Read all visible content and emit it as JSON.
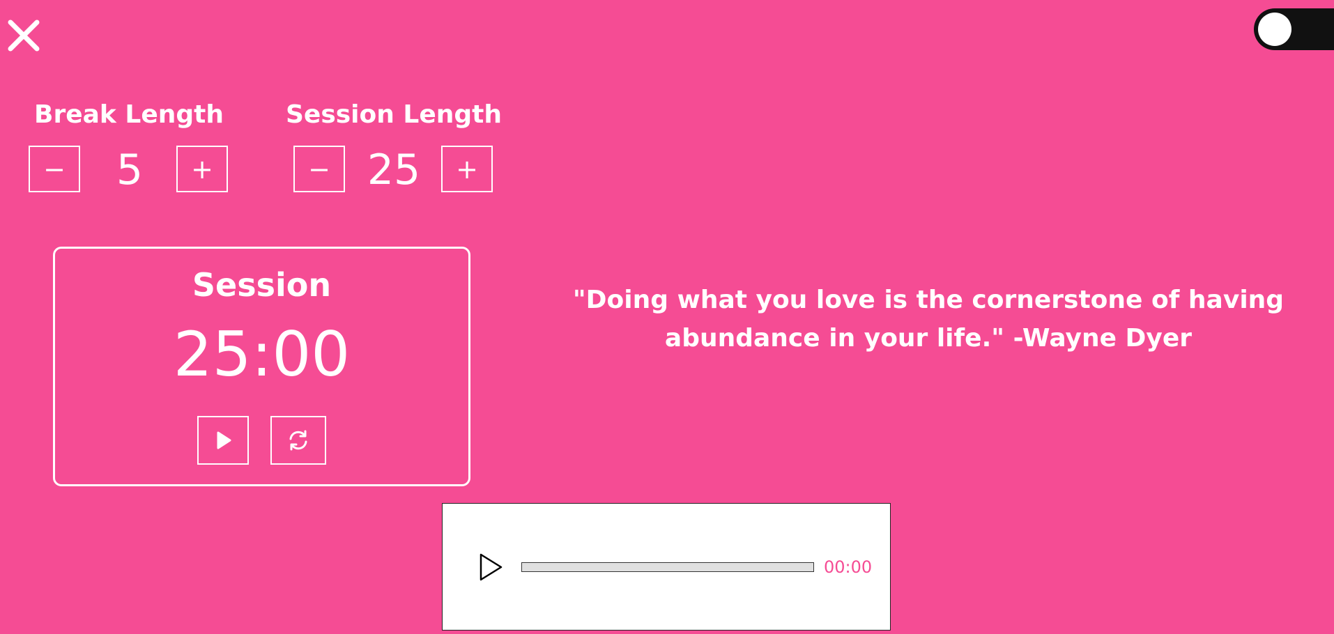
{
  "colors": {
    "background": "#f54c94",
    "foreground": "#ffffff",
    "toggle_track": "#111111",
    "player_accent": "#f54c94"
  },
  "header": {
    "close_icon": "close-icon",
    "theme_toggle": {
      "state": "off"
    }
  },
  "break_length": {
    "title": "Break Length",
    "value": "5",
    "decrement_label": "−",
    "increment_label": "+"
  },
  "session_length": {
    "title": "Session Length",
    "value": "25",
    "decrement_label": "−",
    "increment_label": "+"
  },
  "timer": {
    "label": "Session",
    "time": "25:00",
    "play_icon": "play-icon",
    "reset_icon": "refresh-icon"
  },
  "quote": {
    "text": "\"Doing what you love is the cornerstone of having abundance in your life.\" -Wayne Dyer"
  },
  "audio_player": {
    "play_icon": "play-outline-icon",
    "time": "00:00",
    "progress": 0
  }
}
